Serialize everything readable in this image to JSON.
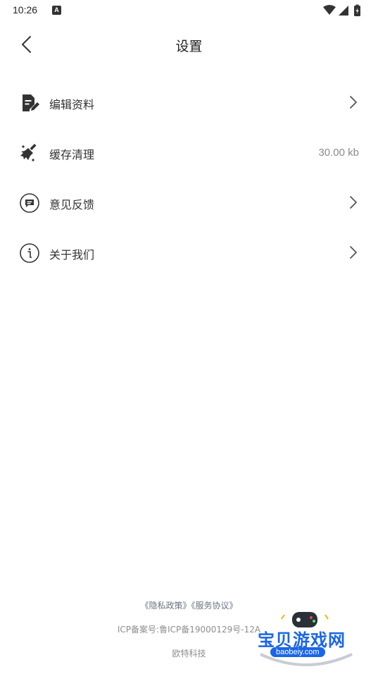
{
  "status_bar": {
    "time": "10:26",
    "badge": "A"
  },
  "header": {
    "title": "设置"
  },
  "settings": [
    {
      "id": "edit-profile",
      "label": "编辑资料",
      "icon": "edit-document-icon",
      "value": ""
    },
    {
      "id": "clear-cache",
      "label": "缓存清理",
      "icon": "broom-icon",
      "value": "30.00 kb"
    },
    {
      "id": "feedback",
      "label": "意见反馈",
      "icon": "message-icon",
      "value": ""
    },
    {
      "id": "about",
      "label": "关于我们",
      "icon": "info-icon",
      "value": ""
    }
  ],
  "footer": {
    "privacy_link": "《隐私政策》",
    "terms_link": "《服务协议》",
    "icp": "ICP备案号:鲁ICP备19000129号-12A",
    "company": "欧特科技"
  },
  "watermark": {
    "text": "宝贝游戏网",
    "url": "baobeiy.com"
  },
  "colors": {
    "text": "#333333",
    "muted": "#8a8a8a",
    "link": "#6a7382",
    "watermark": "#1a66e8"
  }
}
